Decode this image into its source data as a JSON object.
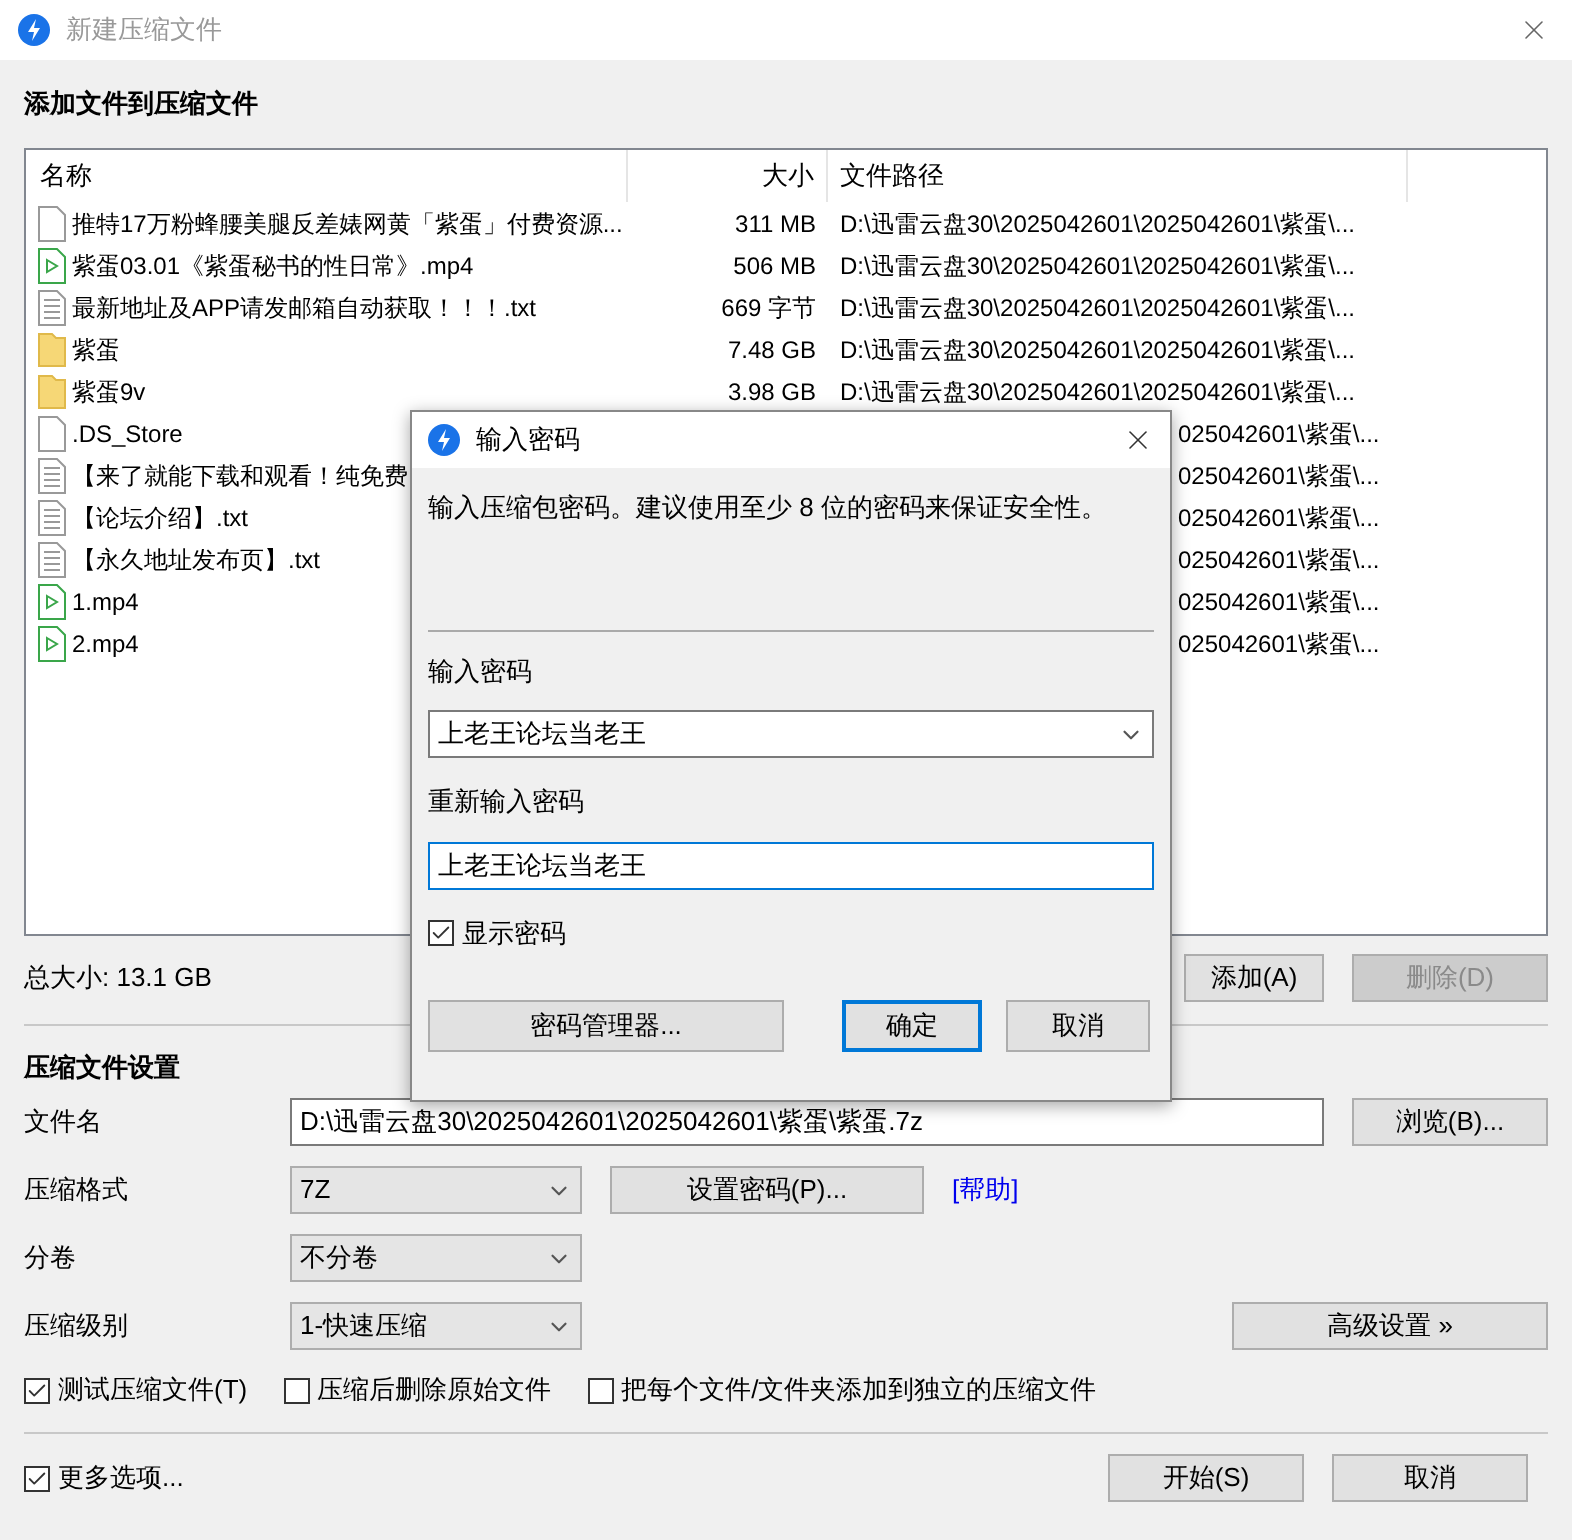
{
  "window": {
    "title": "新建压缩文件"
  },
  "files": {
    "heading": "添加文件到压缩文件",
    "columns": [
      "名称",
      "大小",
      "文件路径"
    ],
    "rows": [
      {
        "kind": "blank",
        "name": "推特17万粉蜂腰美腿反差婊网黄「紫蛋」付费资源...",
        "size": "311 MB",
        "path": "D:\\迅雷云盘30\\2025042601\\2025042601\\紫蛋\\...",
        "path_cut": false
      },
      {
        "kind": "video",
        "name": "紫蛋03.01《紫蛋秘书的性日常》.mp4",
        "size": "506 MB",
        "path": "D:\\迅雷云盘30\\2025042601\\2025042601\\紫蛋\\...",
        "path_cut": false
      },
      {
        "kind": "text",
        "name": "最新地址及APP请发邮箱自动获取！！！.txt",
        "size": "669 字节",
        "path": "D:\\迅雷云盘30\\2025042601\\2025042601\\紫蛋\\...",
        "path_cut": false
      },
      {
        "kind": "folder",
        "name": "紫蛋",
        "size": "7.48 GB",
        "path": "D:\\迅雷云盘30\\2025042601\\2025042601\\紫蛋\\...",
        "path_cut": false
      },
      {
        "kind": "folder",
        "name": "紫蛋9v",
        "size": "3.98 GB",
        "path": "D:\\迅雷云盘30\\2025042601\\2025042601\\紫蛋\\...",
        "path_cut": false
      },
      {
        "kind": "blank",
        "name": ".DS_Store",
        "path": "025042601\\紫蛋\\...",
        "path_cut": true
      },
      {
        "kind": "text",
        "name": "【来了就能下载和观看！纯免费",
        "path": "025042601\\紫蛋\\...",
        "path_cut": true
      },
      {
        "kind": "text",
        "name": "【论坛介绍】.txt",
        "path": "025042601\\紫蛋\\...",
        "path_cut": true
      },
      {
        "kind": "text",
        "name": "【永久地址发布页】.txt",
        "path": "025042601\\紫蛋\\...",
        "path_cut": true
      },
      {
        "kind": "video",
        "name": "1.mp4",
        "path": "025042601\\紫蛋\\...",
        "path_cut": true
      },
      {
        "kind": "video",
        "name": "2.mp4",
        "path": "025042601\\紫蛋\\...",
        "path_cut": true
      }
    ],
    "total": "总大小: 13.1 GB",
    "actions": [
      {
        "label": "添加(A)",
        "disabled": false
      },
      {
        "label": "删除(D)",
        "disabled": true
      }
    ]
  },
  "settings": {
    "heading": "压缩文件设置",
    "filename": {
      "label": "文件名",
      "value": "D:\\迅雷云盘30\\2025042601\\2025042601\\紫蛋\\紫蛋.7z",
      "browse": "浏览(B)..."
    },
    "format": {
      "label": "压缩格式",
      "value": "7Z",
      "password_button": "设置密码(P)...",
      "help": "[帮助]"
    },
    "split": {
      "label": "分卷",
      "value": "不分卷"
    },
    "level": {
      "label": "压缩级别",
      "value": "1-快速压缩",
      "advanced": "高级设置 »"
    },
    "options": [
      {
        "label": "测试压缩文件(T)",
        "checked": true
      },
      {
        "label": "压缩后删除原始文件",
        "checked": false
      },
      {
        "label": "把每个文件/文件夹添加到独立的压缩文件",
        "checked": false
      }
    ]
  },
  "footer": {
    "more": {
      "label": "更多选项...",
      "checked": true
    },
    "buttons": [
      "开始(S)",
      "取消"
    ]
  },
  "dialog": {
    "title": "输入密码",
    "message": "输入压缩包密码。建议使用至少 8 位的密码来保证安全性。",
    "password": {
      "label": "输入密码",
      "value": "上老王论坛当老王"
    },
    "confirm": {
      "label": "重新输入密码",
      "value": "上老王论坛当老王"
    },
    "show": {
      "label": "显示密码",
      "checked": true
    },
    "buttons": [
      {
        "label": "密码管理器...",
        "default": false
      },
      {
        "label": "确定",
        "default": true
      },
      {
        "label": "取消",
        "default": false
      }
    ]
  }
}
